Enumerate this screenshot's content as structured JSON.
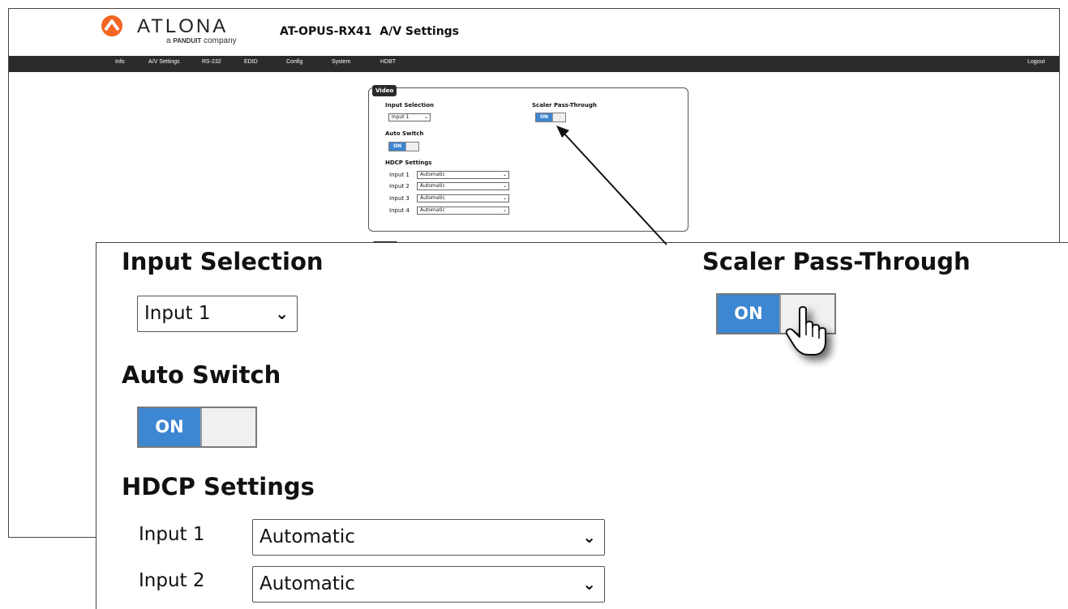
{
  "brand": {
    "wordmark": "ATLONA",
    "sub_prefix": "a",
    "sub_brand": "PANDUIT",
    "sub_suffix": "company",
    "accent": "#f26522"
  },
  "page_title": "AT-OPUS-RX41  A/V Settings",
  "nav": {
    "items": [
      "Info",
      "A/V Settings",
      "RS-232",
      "EDID",
      "Config",
      "System",
      "HDBT"
    ],
    "logout": "Logout"
  },
  "video_panel": {
    "tab": "Video",
    "input_selection_label": "Input Selection",
    "input_selection_value": "Input 1",
    "scaler_label": "Scaler Pass-Through",
    "scaler_state": "ON",
    "auto_switch_label": "Auto Switch",
    "auto_switch_state": "ON",
    "hdcp_label": "HDCP Settings",
    "hdcp_rows": [
      {
        "label": "Input 1",
        "value": "Automatic"
      },
      {
        "label": "Input 2",
        "value": "Automatic"
      },
      {
        "label": "Input 3",
        "value": "Automatic"
      },
      {
        "label": "Input 4",
        "value": "Automatic"
      }
    ]
  },
  "colors": {
    "toggle_on": "#3d86d1",
    "navbar": "#2b2b2b"
  },
  "icons": {
    "chevron": "chevron-down-icon",
    "cursor": "hand-pointer-icon"
  }
}
